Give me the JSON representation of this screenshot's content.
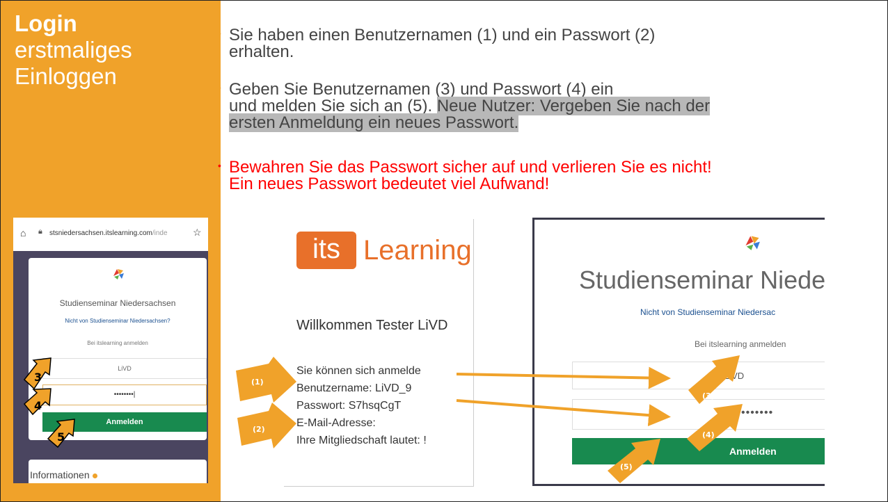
{
  "sidebar": {
    "title_bold": "Login",
    "title_line2": "erstmaliges",
    "title_line3": "Einloggen"
  },
  "bullets": {
    "b1_line1": "Sie haben einen Benutzernamen (1) und ein Passwort (2)",
    "b1_line2": "erhalten.",
    "b2_line1": "Geben Sie Benutzernamen (3) und Passwort (4) ein",
    "b2_line2_plain": "und melden Sie sich an (5). ",
    "b2_line2_hl": "Neue Nutzer: Vergeben Sie nach der",
    "b2_line3_hl": "ersten Anmeldung ein neues Passwort.",
    "b3_line1": "Bewahren Sie das Passwort sicher auf und verlieren Sie es nicht!",
    "b3_line2": "Ein neues Passwort bedeutet viel Aufwand!"
  },
  "left_screenshot": {
    "url_main": "stsniedersachsen.itslearning.com",
    "url_dim": "/inde",
    "title": "Studienseminar Niedersachsen",
    "link": "Nicht von Studienseminar Niedersachsen?",
    "sub": "Bei itslearning anmelden",
    "username": "LiVD",
    "password": "••••••••|",
    "button": "Anmelden",
    "info": "Informationen",
    "callouts": [
      "3",
      "4",
      "5"
    ]
  },
  "middle_panel": {
    "logo_box": "its",
    "logo_word": "Learning",
    "welcome": "Willkommen Tester LiVD",
    "line1": "Sie können sich anmelde",
    "line2": "Benutzername: LiVD_9",
    "line3": "Passwort: S7hsqCgT",
    "line4": "E-Mail-Adresse:",
    "line5": "Ihre Mitgliedschaft lautet: !",
    "callouts": [
      "(1)",
      "(2)"
    ]
  },
  "right_panel": {
    "title": "Studienseminar Niede",
    "link": "Nicht von Studienseminar Niedersac",
    "sub": "Bei itslearning anmelden",
    "username": "LiVD",
    "password": "•••••••",
    "button": "Anmelden",
    "callouts": [
      "(3)",
      "(4)",
      "(5)"
    ]
  },
  "colors": {
    "accent": "#f0a22a",
    "warning": "#ff0000",
    "button_green": "#188a4f",
    "its_orange": "#e8702a"
  }
}
